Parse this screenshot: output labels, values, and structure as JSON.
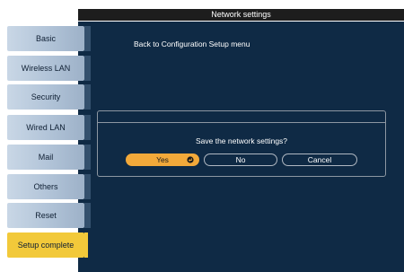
{
  "header": {
    "title": "Network settings"
  },
  "sidebar": {
    "items": [
      {
        "label": "Basic"
      },
      {
        "label": "Wireless LAN"
      },
      {
        "label": "Security"
      },
      {
        "label": "Wired LAN"
      },
      {
        "label": "Mail"
      },
      {
        "label": "Others"
      },
      {
        "label": "Reset"
      },
      {
        "label": "Setup complete",
        "active": true
      }
    ]
  },
  "main": {
    "back_label": "Back to Configuration Setup menu"
  },
  "dialog": {
    "message": "Save the network settings?",
    "yes_label": "Yes",
    "no_label": "No",
    "cancel_label": "Cancel"
  },
  "colors": {
    "background": "#0f2a45",
    "sidebar_button": "#b3c5d9",
    "active_button": "#f2c93a",
    "selected_dialog_button": "#f2a93a"
  },
  "icons": {
    "yes_button_icon": "enter-icon"
  }
}
